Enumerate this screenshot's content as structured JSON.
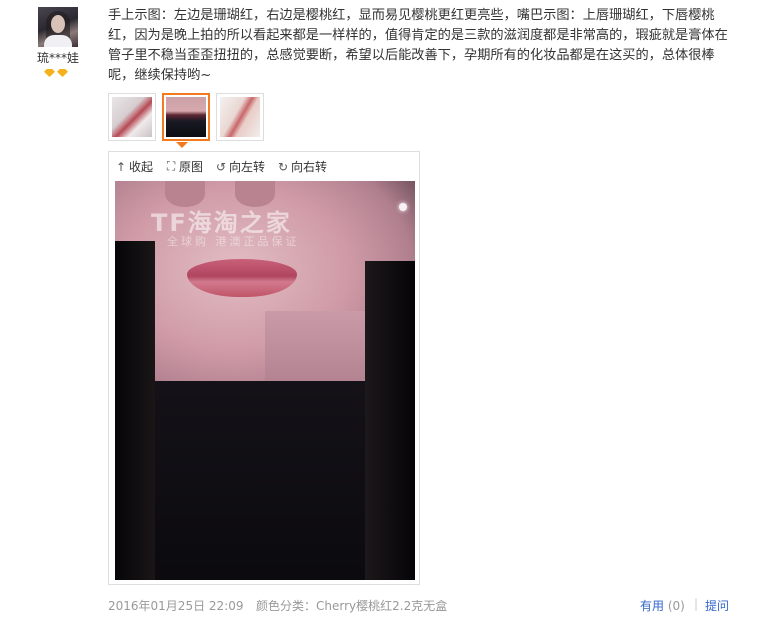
{
  "user": {
    "name": "琉***娃",
    "badges": [
      "diamond-icon",
      "diamond-icon"
    ]
  },
  "review": {
    "text": "手上示图：左边是珊瑚红，右边是樱桃红，显而易见樱桃更红更亮些，嘴巴示图：上唇珊瑚红，下唇樱桃红，因为是晚上拍的所以看起来都是一样样的，值得肯定的是三款的滋润度都是非常高的，瑕疵就是膏体在管子里不稳当歪歪扭扭的，总感觉要断，希望以后能改善下，孕期所有的化妆品都是在这买的，总体很棒呢，继续保持哟~"
  },
  "thumbnails": [
    {
      "icon": "lipstick-photo",
      "active": false
    },
    {
      "icon": "lips-photo",
      "active": true
    },
    {
      "icon": "hand-swatch-photo",
      "active": false
    }
  ],
  "viewer": {
    "toolbar": {
      "collapse": "收起",
      "original": "原图",
      "rotate_left": "向左转",
      "rotate_right": "向右转"
    },
    "watermark": "TF海淘之家",
    "watermark_sub": "全球购  港澳正品保证"
  },
  "footer": {
    "date": "2016年01月25日 22:09",
    "spec": "颜色分类：Cherry樱桃红2.2克无盒",
    "useful_label": "有用",
    "useful_count": "(0)",
    "separator": "|",
    "question": "提问"
  },
  "colors": {
    "accent_border": "#f47a20",
    "link": "#3366cc",
    "meta_text": "#999999"
  }
}
